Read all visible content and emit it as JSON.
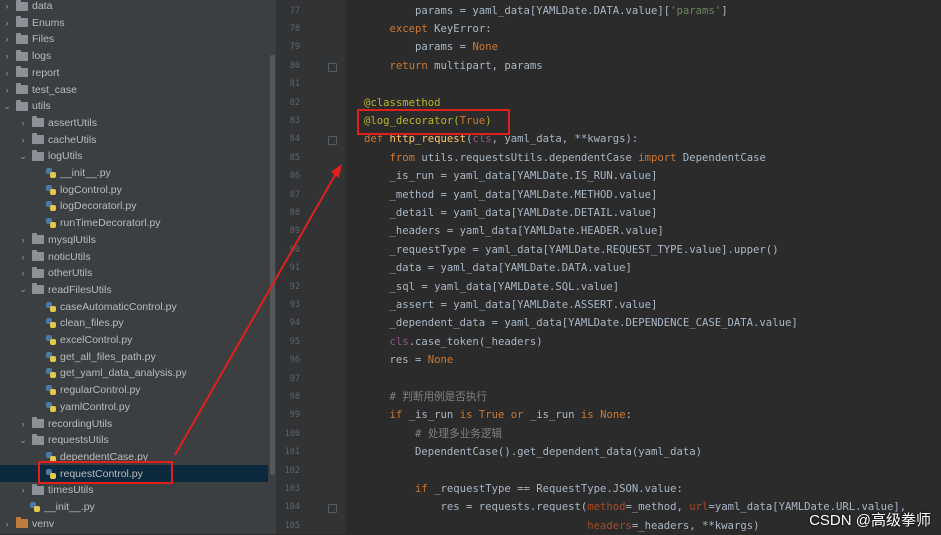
{
  "project_tree": {
    "items": [
      {
        "label": "data",
        "type": "folder",
        "arrow": "collapsed"
      },
      {
        "label": "Enums",
        "type": "folder",
        "arrow": "collapsed"
      },
      {
        "label": "Files",
        "type": "folder",
        "arrow": "collapsed"
      },
      {
        "label": "logs",
        "type": "folder",
        "arrow": "collapsed"
      },
      {
        "label": "report",
        "type": "folder",
        "arrow": "collapsed"
      },
      {
        "label": "test_case",
        "type": "folder",
        "arrow": "collapsed"
      },
      {
        "label": "utils",
        "type": "folder",
        "arrow": "expanded"
      },
      {
        "label": "assertUtils",
        "type": "folder",
        "arrow": "collapsed"
      },
      {
        "label": "cacheUtils",
        "type": "folder",
        "arrow": "collapsed"
      },
      {
        "label": "logUtils",
        "type": "folder",
        "arrow": "expanded"
      },
      {
        "label": "__init__.py",
        "type": "file"
      },
      {
        "label": "logControl.py",
        "type": "file"
      },
      {
        "label": "logDecoratorl.py",
        "type": "file"
      },
      {
        "label": "runTimeDecoratorl.py",
        "type": "file"
      },
      {
        "label": "mysqlUtils",
        "type": "folder",
        "arrow": "collapsed"
      },
      {
        "label": "noticUtils",
        "type": "folder",
        "arrow": "collapsed"
      },
      {
        "label": "otherUtils",
        "type": "folder",
        "arrow": "collapsed"
      },
      {
        "label": "readFilesUtils",
        "type": "folder",
        "arrow": "expanded"
      },
      {
        "label": "caseAutomaticControl.py",
        "type": "file"
      },
      {
        "label": "clean_files.py",
        "type": "file"
      },
      {
        "label": "excelControl.py",
        "type": "file"
      },
      {
        "label": "get_all_files_path.py",
        "type": "file"
      },
      {
        "label": "get_yaml_data_analysis.py",
        "type": "file"
      },
      {
        "label": "regularControl.py",
        "type": "file"
      },
      {
        "label": "yamlControl.py",
        "type": "file"
      },
      {
        "label": "recordingUtils",
        "type": "folder",
        "arrow": "collapsed"
      },
      {
        "label": "requestsUtils",
        "type": "folder",
        "arrow": "expanded"
      },
      {
        "label": "dependentCase.py",
        "type": "file"
      },
      {
        "label": "requestControl.py",
        "type": "file",
        "selected": true
      },
      {
        "label": "timesUtils",
        "type": "folder",
        "arrow": "collapsed"
      },
      {
        "label": "__init__.py",
        "type": "file"
      },
      {
        "label": "venv",
        "type": "folder",
        "arrow": "collapsed",
        "excluded": true
      }
    ]
  },
  "editor": {
    "line_numbers": [
      "77",
      "78",
      "79",
      "80",
      "81",
      "82",
      "83",
      "84",
      "85",
      "86",
      "87",
      "88",
      "89",
      "90",
      "91",
      "92",
      "93",
      "94",
      "95",
      "96",
      "97",
      "98",
      "99",
      "100",
      "101",
      "102",
      "103",
      "104",
      "105"
    ],
    "lines": [
      [
        {
          "t": "        params = yaml_data[YAMLDate.DATA.value]["
        },
        {
          "t": "'params'",
          "c": "st"
        },
        {
          "t": "]"
        }
      ],
      [
        {
          "t": "    "
        },
        {
          "t": "except",
          "c": "kw"
        },
        {
          "t": " KeyError:"
        }
      ],
      [
        {
          "t": "        params = "
        },
        {
          "t": "None",
          "c": "kw"
        }
      ],
      [
        {
          "t": "    "
        },
        {
          "t": "return",
          "c": "kw"
        },
        {
          "t": " multipart, params"
        }
      ],
      [],
      [
        {
          "t": "@classmethod",
          "c": "dec"
        }
      ],
      [
        {
          "t": "@log_decorator(",
          "c": "dec"
        },
        {
          "t": "True",
          "c": "kw"
        },
        {
          "t": ")",
          "c": "dec"
        }
      ],
      [
        {
          "t": "def ",
          "c": "kw"
        },
        {
          "t": "http_request",
          "c": "fn"
        },
        {
          "t": "("
        },
        {
          "t": "cls",
          "c": "self"
        },
        {
          "t": ", yaml_data, **kwargs):"
        }
      ],
      [
        {
          "t": "    "
        },
        {
          "t": "from",
          "c": "kw"
        },
        {
          "t": " utils.requestsUtils.dependentCase "
        },
        {
          "t": "import",
          "c": "kw"
        },
        {
          "t": " DependentCase"
        }
      ],
      [
        {
          "t": "    _is_run = yaml_data[YAMLDate.IS_RUN.value]"
        }
      ],
      [
        {
          "t": "    _method = yaml_data[YAMLDate.METHOD.value]"
        }
      ],
      [
        {
          "t": "    _detail = yaml_data[YAMLDate.DETAIL.value]"
        }
      ],
      [
        {
          "t": "    _headers = yaml_data[YAMLDate.HEADER.value]"
        }
      ],
      [
        {
          "t": "    _requestType = yaml_data[YAMLDate.REQUEST_TYPE.value].upper()"
        }
      ],
      [
        {
          "t": "    _data = yaml_data[YAMLDate.DATA.value]"
        }
      ],
      [
        {
          "t": "    _sql = yaml_data[YAMLDate.SQL.value]"
        }
      ],
      [
        {
          "t": "    _assert = yaml_data[YAMLDate.ASSERT.value]"
        }
      ],
      [
        {
          "t": "    _dependent_data = yaml_data[YAMLDate.DEPENDENCE_CASE_DATA.value]"
        }
      ],
      [
        {
          "t": "    "
        },
        {
          "t": "cls",
          "c": "self"
        },
        {
          "t": ".case_token(_headers)"
        }
      ],
      [
        {
          "t": "    res = "
        },
        {
          "t": "None",
          "c": "kw"
        }
      ],
      [],
      [
        {
          "t": "    "
        },
        {
          "t": "# 判断用例是否执行",
          "c": "cm"
        }
      ],
      [
        {
          "t": "    "
        },
        {
          "t": "if",
          "c": "kw"
        },
        {
          "t": " _is_run "
        },
        {
          "t": "is",
          "c": "kw"
        },
        {
          "t": " "
        },
        {
          "t": "True",
          "c": "kw"
        },
        {
          "t": " "
        },
        {
          "t": "or",
          "c": "kw"
        },
        {
          "t": " _is_run "
        },
        {
          "t": "is",
          "c": "kw"
        },
        {
          "t": " "
        },
        {
          "t": "None",
          "c": "kw"
        },
        {
          "t": ":"
        }
      ],
      [
        {
          "t": "        "
        },
        {
          "t": "# 处理多业务逻辑",
          "c": "cm"
        }
      ],
      [
        {
          "t": "        DependentCase().get_dependent_data(yaml_data)"
        }
      ],
      [],
      [
        {
          "t": "        "
        },
        {
          "t": "if",
          "c": "kw"
        },
        {
          "t": " _requestType == RequestType.JSON.value:"
        }
      ],
      [
        {
          "t": "            res = requests.request("
        },
        {
          "t": "method",
          "c": "param"
        },
        {
          "t": "=_method, "
        },
        {
          "t": "url",
          "c": "param"
        },
        {
          "t": "=yaml_data[YAMLDate.URL.value],"
        }
      ],
      [
        {
          "t": "                                   "
        },
        {
          "t": "headers",
          "c": "param"
        },
        {
          "t": "=_headers, **kwargs)"
        }
      ]
    ]
  },
  "watermark": "CSDN @高级拳师",
  "highlight_color": "#e0201c"
}
